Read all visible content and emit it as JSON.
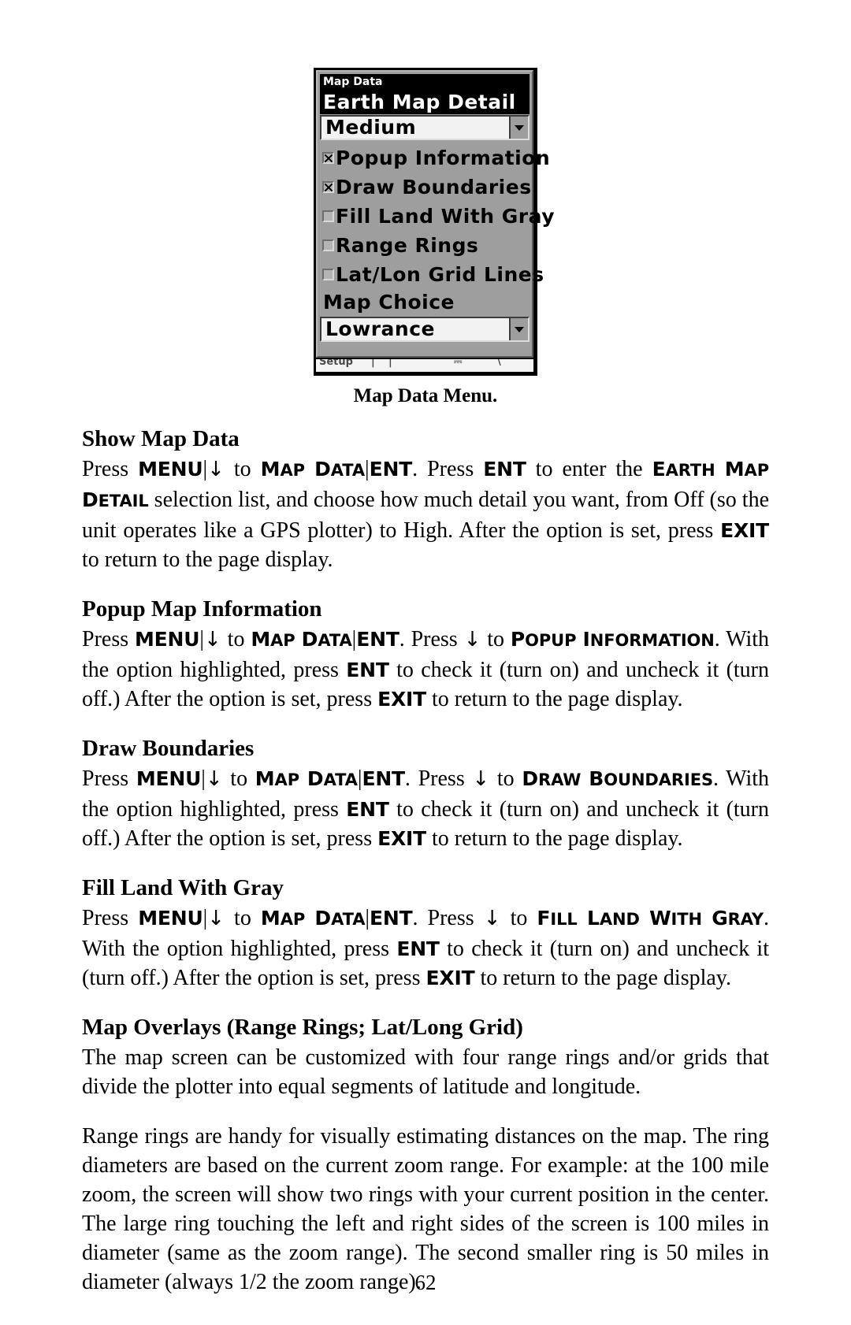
{
  "figure": {
    "caption": "Map Data Menu.",
    "menu": {
      "title": "Map Data",
      "highlighted_row": "Earth Map Detail",
      "detail_select_value": "Medium",
      "checkboxes": [
        {
          "label": "Popup Information",
          "checked": true
        },
        {
          "label": "Draw Boundaries",
          "checked": true
        },
        {
          "label": "Fill Land With Gray",
          "checked": false
        },
        {
          "label": "Range Rings",
          "checked": false
        },
        {
          "label": "Lat/Lon Grid Lines",
          "checked": false
        }
      ],
      "map_choice_label": "Map Choice",
      "map_choice_value": "Lowrance"
    }
  },
  "sections": [
    {
      "heading": "Show Map Data",
      "paragraphs": [
        {
          "runs": [
            {
              "t": "Press ",
              "s": "n"
            },
            {
              "t": "MENU",
              "s": "k"
            },
            {
              "t": "|",
              "s": "p"
            },
            {
              "t": "↓",
              "s": "a"
            },
            {
              "t": " to ",
              "s": "n"
            },
            {
              "t": "Map Data",
              "s": "c"
            },
            {
              "t": "|",
              "s": "p"
            },
            {
              "t": "ENT",
              "s": "k"
            },
            {
              "t": ". Press ",
              "s": "n"
            },
            {
              "t": "ENT",
              "s": "k"
            },
            {
              "t": " to enter the ",
              "s": "n"
            },
            {
              "t": "Earth Map Detail",
              "s": "c"
            },
            {
              "t": " selection list, and choose how much detail you want, from Off (so the unit operates like a GPS plotter) to High. After the option is set, press ",
              "s": "n"
            },
            {
              "t": "EXIT",
              "s": "k"
            },
            {
              "t": " to return to the page display.",
              "s": "n"
            }
          ]
        }
      ]
    },
    {
      "heading": "Popup Map Information",
      "paragraphs": [
        {
          "runs": [
            {
              "t": "Press ",
              "s": "n"
            },
            {
              "t": "MENU",
              "s": "k"
            },
            {
              "t": "|",
              "s": "p"
            },
            {
              "t": "↓",
              "s": "a"
            },
            {
              "t": " to ",
              "s": "n"
            },
            {
              "t": "Map Data",
              "s": "c"
            },
            {
              "t": "|",
              "s": "p"
            },
            {
              "t": "ENT",
              "s": "k"
            },
            {
              "t": ". Press ",
              "s": "n"
            },
            {
              "t": "↓",
              "s": "a"
            },
            {
              "t": " to ",
              "s": "n"
            },
            {
              "t": "Popup Information",
              "s": "c"
            },
            {
              "t": ". With the option highlighted, press ",
              "s": "n"
            },
            {
              "t": "ENT",
              "s": "k"
            },
            {
              "t": " to check it (turn on) and uncheck it (turn off.) After the option is set, press ",
              "s": "n"
            },
            {
              "t": "EXIT",
              "s": "k"
            },
            {
              "t": " to return to the page display.",
              "s": "n"
            }
          ]
        }
      ]
    },
    {
      "heading": "Draw Boundaries",
      "paragraphs": [
        {
          "runs": [
            {
              "t": "Press ",
              "s": "n"
            },
            {
              "t": "MENU",
              "s": "k"
            },
            {
              "t": "|",
              "s": "p"
            },
            {
              "t": "↓",
              "s": "a"
            },
            {
              "t": " to ",
              "s": "n"
            },
            {
              "t": "Map Data",
              "s": "c"
            },
            {
              "t": "|",
              "s": "p"
            },
            {
              "t": "ENT",
              "s": "k"
            },
            {
              "t": ". Press ",
              "s": "n"
            },
            {
              "t": "↓",
              "s": "a"
            },
            {
              "t": " to ",
              "s": "n"
            },
            {
              "t": "Draw Boundaries",
              "s": "c"
            },
            {
              "t": ". With the option highlighted, press ",
              "s": "n"
            },
            {
              "t": "ENT",
              "s": "k"
            },
            {
              "t": " to check it (turn on) and uncheck it (turn off.) After the option is set, press ",
              "s": "n"
            },
            {
              "t": "EXIT",
              "s": "k"
            },
            {
              "t": " to return to the page display.",
              "s": "n"
            }
          ]
        }
      ]
    },
    {
      "heading": "Fill Land With Gray",
      "paragraphs": [
        {
          "runs": [
            {
              "t": "Press ",
              "s": "n"
            },
            {
              "t": "MENU",
              "s": "k"
            },
            {
              "t": "|",
              "s": "p"
            },
            {
              "t": "↓",
              "s": "a"
            },
            {
              "t": " to ",
              "s": "n"
            },
            {
              "t": "Map Data",
              "s": "c"
            },
            {
              "t": "|",
              "s": "p"
            },
            {
              "t": "ENT",
              "s": "k"
            },
            {
              "t": ". Press ",
              "s": "n"
            },
            {
              "t": "↓",
              "s": "a"
            },
            {
              "t": " to ",
              "s": "n"
            },
            {
              "t": "Fill Land With Gray",
              "s": "c"
            },
            {
              "t": ". With the option highlighted, press ",
              "s": "n"
            },
            {
              "t": "ENT",
              "s": "k"
            },
            {
              "t": " to check it (turn on) and uncheck it (turn off.) After the option is set, press ",
              "s": "n"
            },
            {
              "t": "EXIT",
              "s": "k"
            },
            {
              "t": " to return to the page display.",
              "s": "n"
            }
          ]
        }
      ]
    },
    {
      "heading": "Map Overlays (Range Rings; Lat/Long Grid)",
      "paragraphs": [
        {
          "runs": [
            {
              "t": "The map screen can be customized with four range rings and/or grids that divide the plotter into equal segments of latitude and longitude.",
              "s": "n"
            }
          ]
        },
        {
          "runs": [
            {
              "t": "Range rings are handy for visually estimating distances on the map. The ring diameters are based on the current zoom range. For example: at the 100 mile zoom, the screen will show two rings with your current position in the center. The large ring touching the left and right sides of the screen is 100 miles in diameter (same as the zoom range). The second smaller ring is 50 miles in diameter (always 1/2 the zoom range).",
              "s": "n"
            }
          ]
        }
      ]
    }
  ],
  "page_number": "62"
}
